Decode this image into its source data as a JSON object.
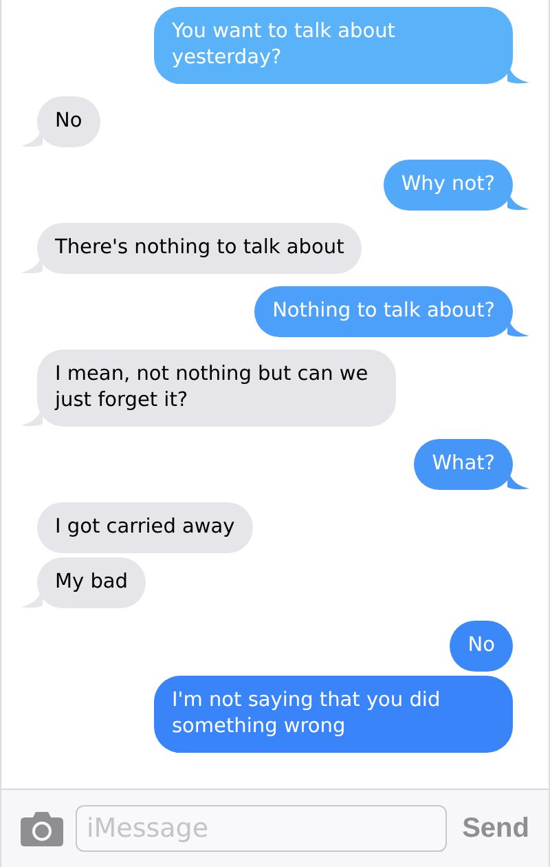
{
  "messages": [
    {
      "text": "You want to talk about yesterday?",
      "kind": "sent",
      "tail": true
    },
    {
      "text": "No",
      "kind": "received",
      "tail": true
    },
    {
      "text": "Why not?",
      "kind": "sent",
      "tail": true
    },
    {
      "text": "There's nothing to talk about",
      "kind": "received",
      "tail": true
    },
    {
      "text": "Nothing to talk about?",
      "kind": "sent",
      "tail": true
    },
    {
      "text": "I mean, not nothing but can we just forget it?",
      "kind": "received",
      "tail": true
    },
    {
      "text": "What?",
      "kind": "sent",
      "tail": true
    },
    {
      "text": "I got carried away",
      "kind": "received",
      "tail": false
    },
    {
      "text": "My bad",
      "kind": "received",
      "tail": true
    },
    {
      "text": "No",
      "kind": "sent",
      "tail": false
    },
    {
      "text": "I'm not saying that you did something wrong",
      "kind": "sent",
      "tail": false
    }
  ],
  "composer": {
    "placeholder": "iMessage",
    "send": "Send"
  }
}
